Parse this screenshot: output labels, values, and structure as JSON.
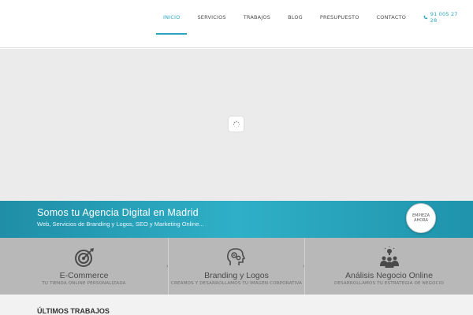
{
  "nav": {
    "items": [
      {
        "label": "INICIO",
        "active": true
      },
      {
        "label": "SERVICIOS",
        "active": false
      },
      {
        "label": "TRABAJOS",
        "active": false
      },
      {
        "label": "BLOG",
        "active": false
      },
      {
        "label": "PRESUPUESTO",
        "active": false
      },
      {
        "label": "CONTACTO",
        "active": false
      }
    ],
    "phone": "91 005 27 28"
  },
  "slider": {
    "loader_icon": "spinner-icon"
  },
  "banner": {
    "title": "Somos tu Agencia Digital en Madrid",
    "subtitle": "Web, Servicios de Branding y Logos, SEO y Marketing Online...",
    "cta_line1": "EMPIEZA",
    "cta_line2": "AHORA"
  },
  "services": [
    {
      "title": "E-Commerce",
      "subtitle": "TU TIENDA ONLINE PERSONALIZADA",
      "icon": "target-icon"
    },
    {
      "title": "Branding y Logos",
      "subtitle": "CREAMOS Y DESARROLLAMOS TU IMAGEN CORPORATIVA",
      "icon": "head-gears-icon"
    },
    {
      "title": "Análisis Negocio Online",
      "subtitle": "DESARROLLAMOS TU ESTRATEGIA DE NEGOCIO",
      "icon": "team-idea-icon"
    }
  ],
  "works": {
    "title": "ÚLTIMOS TRABAJOS"
  },
  "colors": {
    "accent": "#2aa4bf",
    "banner": "#2fb0c8",
    "services_bg": "#b8b8b8"
  }
}
